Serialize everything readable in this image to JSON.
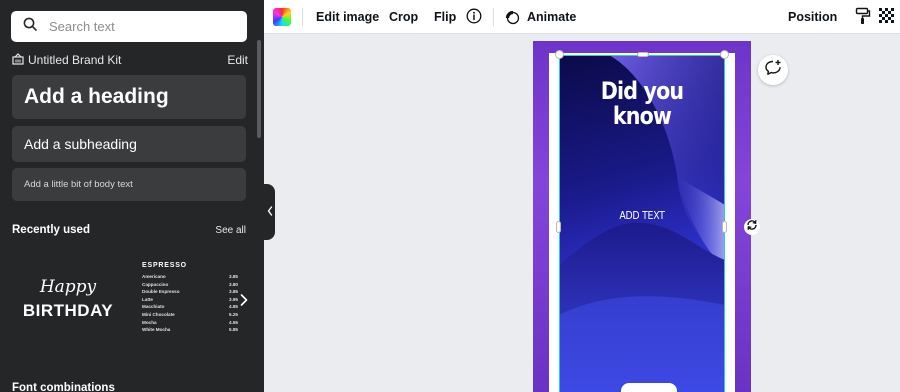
{
  "colors": {
    "panel_bg": "#252627",
    "panel_button": "#3b3c3e",
    "toolbar_bg": "#ffffff",
    "workspace_bg": "#ebecf0",
    "page_purple": "#7a3fd2",
    "selection_accent": "#1fd1e6",
    "artwork_dark": "#0b0a49",
    "artwork_light": "#4c5bf0"
  },
  "sidebar": {
    "search": {
      "placeholder": "Search text",
      "icon": "search-icon"
    },
    "brand_kit": {
      "name": "Untitled Brand Kit",
      "edit_label": "Edit",
      "icon": "brand-kit-icon"
    },
    "text_styles": {
      "heading": "Add a heading",
      "subheading": "Add a subheading",
      "body": "Add a little bit of body text"
    },
    "recently_used": {
      "title": "Recently used",
      "see_all": "See all",
      "items": [
        {
          "line1": "Happy",
          "line2": "BIRTHDAY"
        },
        {
          "title": "ESPRESSO",
          "rows": [
            {
              "name": "Americano",
              "price": "3.85"
            },
            {
              "name": "Cappuccino",
              "price": "3.80"
            },
            {
              "name": "Double Espresso",
              "price": "3.85"
            },
            {
              "name": "Latte",
              "price": "3.95"
            },
            {
              "name": "Macchiato",
              "price": "4.85"
            },
            {
              "name": "Mini Chocolate",
              "price": "5.25"
            },
            {
              "name": "Mocha",
              "price": "4.55"
            },
            {
              "name": "White Mocha",
              "price": "5.85"
            }
          ]
        }
      ]
    },
    "font_combinations_title": "Font combinations"
  },
  "toolbar": {
    "edit_image": "Edit image",
    "crop": "Crop",
    "flip": "Flip",
    "animate": "Animate",
    "position": "Position"
  },
  "canvas": {
    "title": "Did you know",
    "add_text": "ADD TEXT"
  }
}
